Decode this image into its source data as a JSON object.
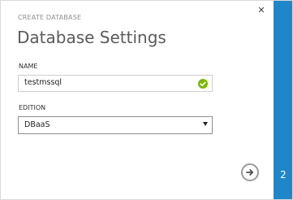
{
  "header": {
    "kicker": "CREATE DATABASE",
    "title": "Database Settings"
  },
  "form": {
    "name_label": "NAME",
    "name_value": "testmssql",
    "edition_label": "EDITION",
    "edition_value": "DBaaS"
  },
  "footer": {
    "step_number": "2"
  },
  "icons": {
    "close": "close-icon",
    "valid": "check-icon",
    "next": "arrow-right-icon",
    "select_chevron": "chevron-down-icon"
  },
  "colors": {
    "rail": "#1f87c9",
    "success": "#7ab800",
    "title": "#5b5b5b"
  }
}
